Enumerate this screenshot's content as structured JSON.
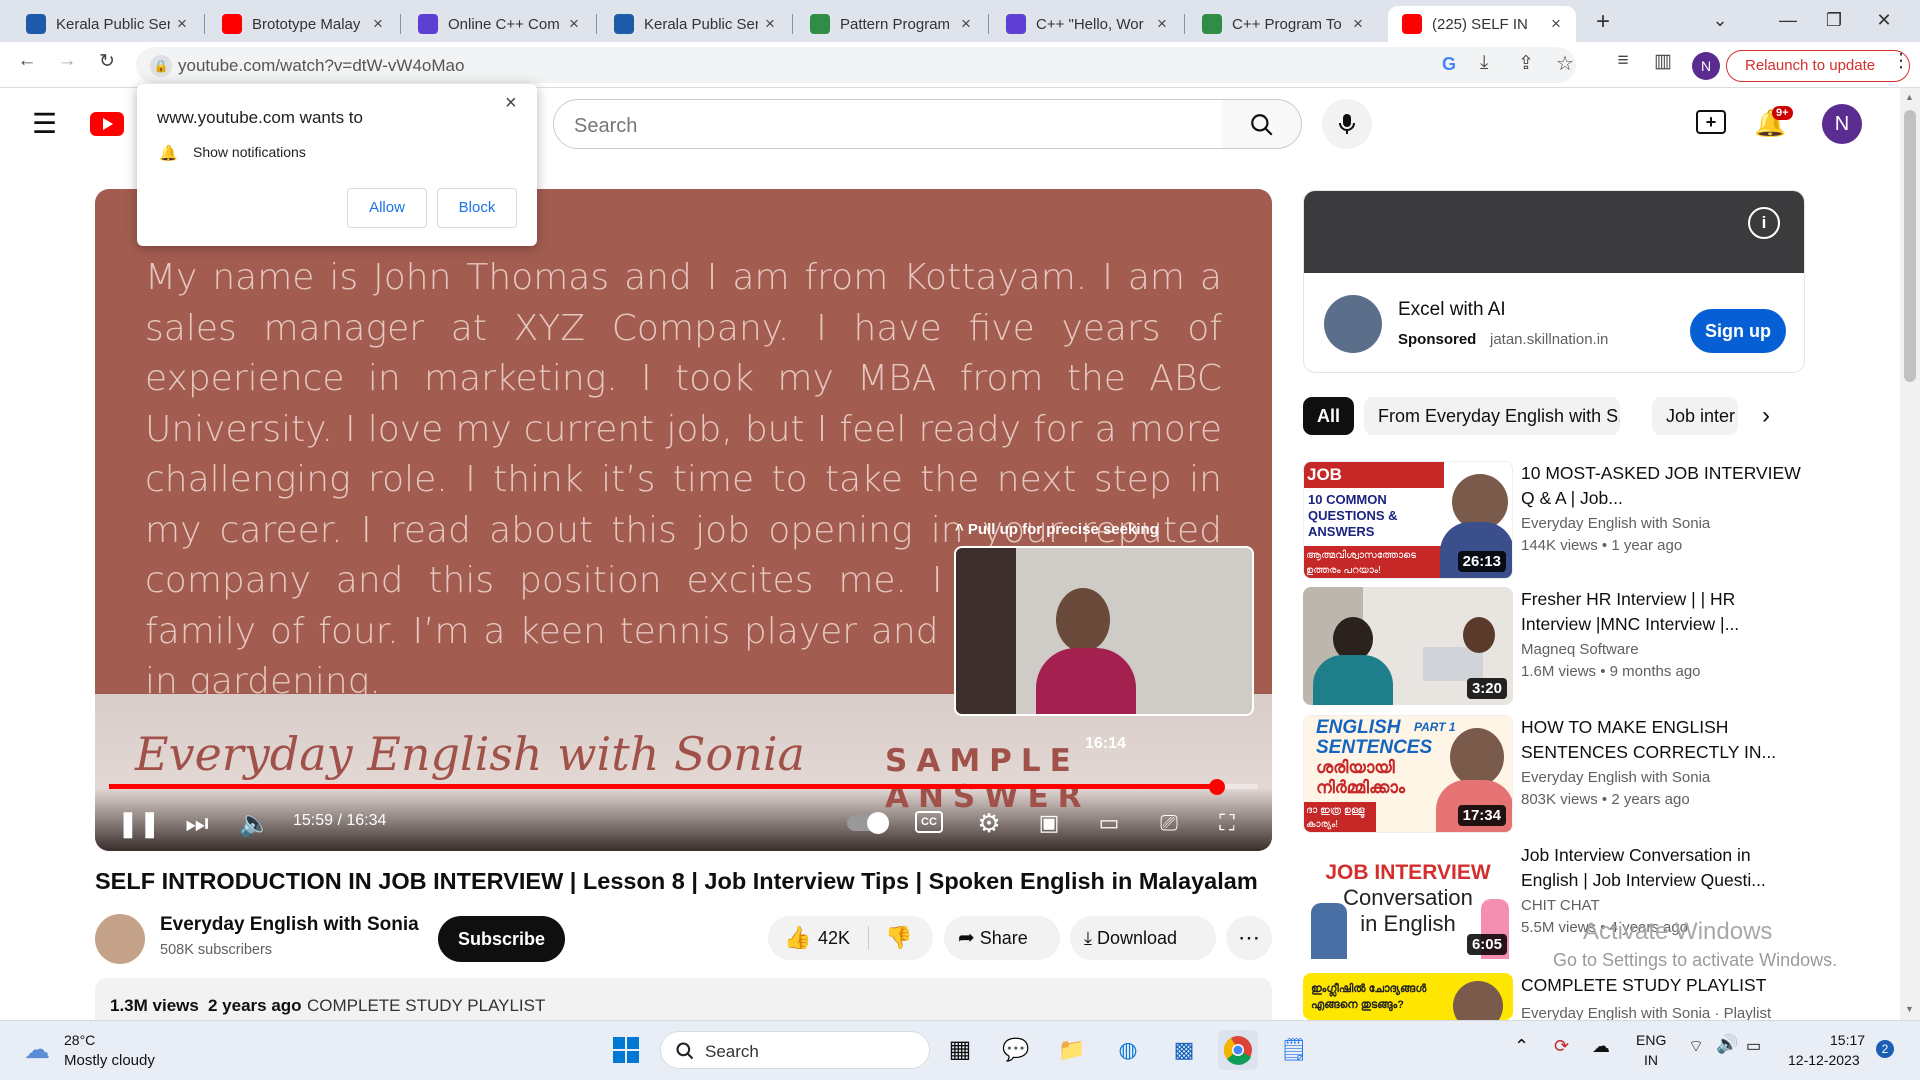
{
  "browser": {
    "tabs": [
      {
        "title": "Kerala Public Ser",
        "favicon": "kerala-psc-icon",
        "color": "#1e5aa8"
      },
      {
        "title": "Brototype Malay",
        "favicon": "youtube-icon",
        "color": "#ff0000"
      },
      {
        "title": "Online C++ Com",
        "favicon": "p-logo-icon",
        "color": "#5d3fd3"
      },
      {
        "title": "Kerala Public Ser",
        "favicon": "kerala-psc-icon",
        "color": "#1e5aa8"
      },
      {
        "title": "Pattern Program",
        "favicon": "gfg-icon",
        "color": "#2f8d46"
      },
      {
        "title": "C++ \"Hello, Wor",
        "favicon": "p-logo-icon",
        "color": "#5d3fd3"
      },
      {
        "title": "C++ Program To",
        "favicon": "gfg-icon",
        "color": "#2f8d46"
      },
      {
        "title": "(225) SELF IN",
        "favicon": "youtube-icon",
        "color": "#ff0000",
        "active": true
      }
    ],
    "new_tab": "+",
    "url": "youtube.com/watch?v=dtW-vW4oMao",
    "relaunch_label": "Relaunch to update",
    "profile_initial": "N"
  },
  "popup": {
    "title": "www.youtube.com wants to",
    "item": "Show notifications",
    "allow": "Allow",
    "block": "Block",
    "close": "×"
  },
  "youtube": {
    "search_placeholder": "Search",
    "notif_count": "9+",
    "avatar": "N"
  },
  "player": {
    "caption_text": "My name is John Thomas and I am from Kottayam. I am a sales manager at XYZ Company. I have five years of experience in marketing. I took my MBA from the ABC University. I love my current job, but I feel ready for a more challenging role. I think it’s time to take the next step in my career. I read about this job opening in your reputed company and this position excites me. I come from a family of four. I’m a keen tennis player and also interested in gardening.",
    "brand_text": "Everyday English with Sonia",
    "sample_text": "SAMPLE ANSWER",
    "seek_tip": "^ Pull up for precise seeking",
    "preview_time": "16:14",
    "time_label": "15:59 / 16:34",
    "progress": 0.9645,
    "cc_label": "CC"
  },
  "video": {
    "title": "SELF INTRODUCTION IN JOB INTERVIEW | Lesson 8 | Job Interview Tips | Spoken English in Malayalam",
    "channel": "Everyday English with Sonia",
    "subscribers": "508K subscribers",
    "subscribe_label": "Subscribe",
    "likes": "42K",
    "share_label": "Share",
    "download_label": "Download",
    "views": "1.3M views",
    "age": "2 years ago",
    "desc_snippet": "COMPLETE STUDY PLAYLIST"
  },
  "ad": {
    "title": "Excel with AI",
    "sponsored": "Sponsored",
    "domain": "jatan.skillnation.in",
    "cta": "Sign up"
  },
  "chips": [
    "All",
    "From Everyday English with S...",
    "Job inter"
  ],
  "recommendations": [
    {
      "title": "10 MOST-ASKED JOB INTERVIEW Q & A | Job...",
      "channel": "Everyday English with Sonia",
      "views": "144K views",
      "age": "1 year ago",
      "duration": "26:13",
      "thumb_text": "JOB INTERVIEW:",
      "thumb_sub": "10 COMMON QUESTIONS & ANSWERS",
      "thumb_ml": "ആത്മവിശ്വാസത്തോടെ ഉത്തരം പറയാം!"
    },
    {
      "title": "Fresher HR Interview | | HR Interview |MNC Interview |...",
      "channel": "Magneq Software",
      "views": "1.6M views",
      "age": "9 months ago",
      "duration": "3:20"
    },
    {
      "title": "HOW TO MAKE ENGLISH SENTENCES CORRECTLY IN...",
      "channel": "Everyday English with Sonia",
      "views": "803K views",
      "age": "2 years ago",
      "duration": "17:34",
      "thumb_text": "ENGLISH SENTENCES",
      "thumb_part": "PART 1",
      "thumb_ml": "ശരിയായി നിർമ്മിക്കാം",
      "thumb_ml2": "ദാ ഇത്ര ഉള്ളൂ കാര്യം!"
    },
    {
      "title": "Job Interview Conversation in English | Job Interview Questi...",
      "channel": "CHIT CHAT",
      "views": "5.5M views",
      "age": "4 years ago",
      "duration": "6:05",
      "thumb_text": "JOB INTERVIEW",
      "thumb_sub": "Conversation in English"
    },
    {
      "title": "COMPLETE STUDY PLAYLIST",
      "channel": "Everyday English with Sonia · Playlist",
      "thumb_ml": "ഇംഗ്ലീഷിൽ ചോദ്യങ്ങൾ എങ്ങനെ തുടങ്ങും?"
    }
  ],
  "watermark": {
    "line1": "Activate Windows",
    "line2": "Go to Settings to activate Windows."
  },
  "taskbar": {
    "weather_temp": "28°C",
    "weather_desc": "Mostly cloudy",
    "search": "Search",
    "lang1": "ENG",
    "lang2": "IN",
    "time": "15:17",
    "date": "12-12-2023",
    "notif": "2"
  }
}
